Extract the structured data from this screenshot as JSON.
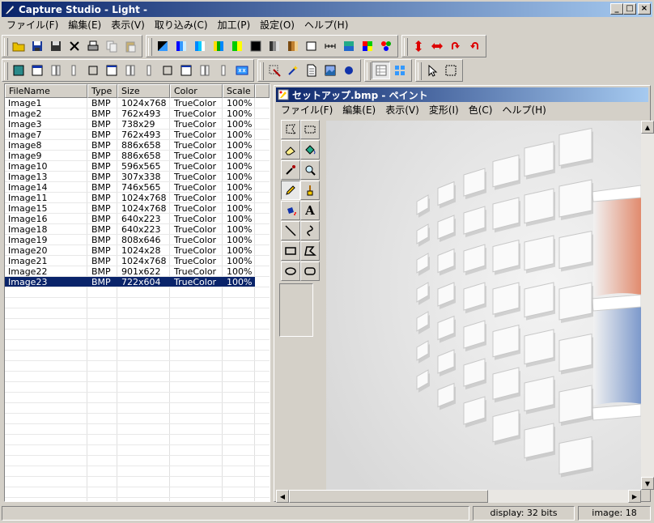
{
  "window": {
    "title": "Capture Studio - Light -",
    "min": "_",
    "max": "□",
    "close": "×"
  },
  "menu": [
    "ファイル(F)",
    "編集(E)",
    "表示(V)",
    "取り込み(C)",
    "加工(P)",
    "設定(O)",
    "ヘルプ(H)"
  ],
  "list": {
    "headers": [
      "FileName",
      "Type",
      "Size",
      "Color",
      "Scale"
    ],
    "rows": [
      [
        "Image1",
        "BMP",
        "1024x768",
        "TrueColor",
        "100%"
      ],
      [
        "Image2",
        "BMP",
        "762x493",
        "TrueColor",
        "100%"
      ],
      [
        "Image3",
        "BMP",
        "738x29",
        "TrueColor",
        "100%"
      ],
      [
        "Image7",
        "BMP",
        "762x493",
        "TrueColor",
        "100%"
      ],
      [
        "Image8",
        "BMP",
        "886x658",
        "TrueColor",
        "100%"
      ],
      [
        "Image9",
        "BMP",
        "886x658",
        "TrueColor",
        "100%"
      ],
      [
        "Image10",
        "BMP",
        "596x565",
        "TrueColor",
        "100%"
      ],
      [
        "Image13",
        "BMP",
        "307x338",
        "TrueColor",
        "100%"
      ],
      [
        "Image14",
        "BMP",
        "746x565",
        "TrueColor",
        "100%"
      ],
      [
        "Image11",
        "BMP",
        "1024x768",
        "TrueColor",
        "100%"
      ],
      [
        "Image15",
        "BMP",
        "1024x768",
        "TrueColor",
        "100%"
      ],
      [
        "Image16",
        "BMP",
        "640x223",
        "TrueColor",
        "100%"
      ],
      [
        "Image18",
        "BMP",
        "640x223",
        "TrueColor",
        "100%"
      ],
      [
        "Image19",
        "BMP",
        "808x646",
        "TrueColor",
        "100%"
      ],
      [
        "Image20",
        "BMP",
        "1024x28",
        "TrueColor",
        "100%"
      ],
      [
        "Image21",
        "BMP",
        "1024x768",
        "TrueColor",
        "100%"
      ],
      [
        "Image22",
        "BMP",
        "901x622",
        "TrueColor",
        "100%"
      ],
      [
        "Image23",
        "BMP",
        "722x604",
        "TrueColor",
        "100%"
      ]
    ],
    "selected_index": 17
  },
  "paint": {
    "title": "セットアップ.bmp - ペイント",
    "menu": [
      "ファイル(F)",
      "編集(E)",
      "表示(V)",
      "変形(I)",
      "色(C)",
      "ヘルプ(H)"
    ],
    "text_tool_label": "A"
  },
  "status": {
    "display": "display: 32 bits",
    "image": "image: 18"
  },
  "colors": {
    "titlebar_start": "#0a246a",
    "titlebar_end": "#a6caf0",
    "face": "#d4d0c8",
    "selection": "#0a246a"
  }
}
